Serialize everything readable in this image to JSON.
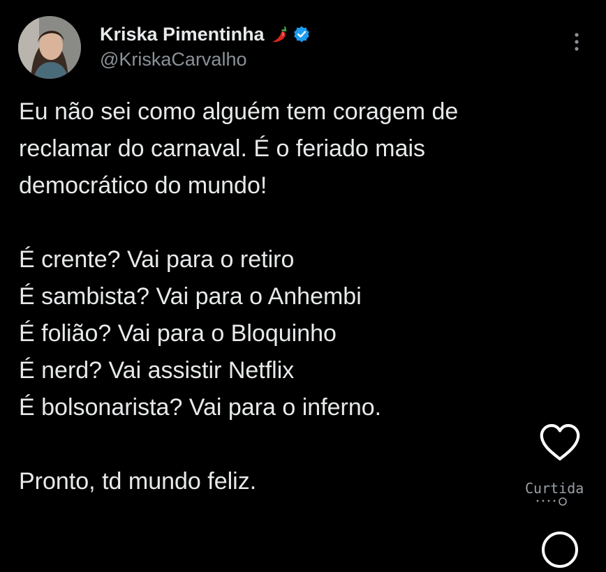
{
  "user": {
    "display_name": "Kriska Pimentinha",
    "handle": "@KriskaCarvalho",
    "avatar_icon": "avatar-photo",
    "badge_icon": "verified-badge-icon",
    "name_emoji_icon": "chili-pepper-icon",
    "verified_color": "#1d9bf0"
  },
  "tweet": {
    "lines": [
      "Eu não sei como alguém tem coragem de",
      "reclamar do carnaval. É o feriado mais",
      "democrático do mundo!",
      "",
      "É crente? Vai para o retiro",
      "É sambista? Vai para o Anhembi",
      "É folião? Vai para o Bloquinho",
      "É nerd? Vai assistir Netflix",
      "É bolsonarista? Vai para o inferno.",
      "",
      "Pronto, td mundo feliz."
    ]
  },
  "actions": {
    "like_label": "Curtida",
    "like_icon": "heart-outline-icon",
    "comment_icon": "comment-bubble-icon",
    "more_icon": "more-vertical-icon"
  },
  "theme": {
    "background": "#000000",
    "text": "#e7e9ea",
    "secondary_text": "#8b9197"
  }
}
